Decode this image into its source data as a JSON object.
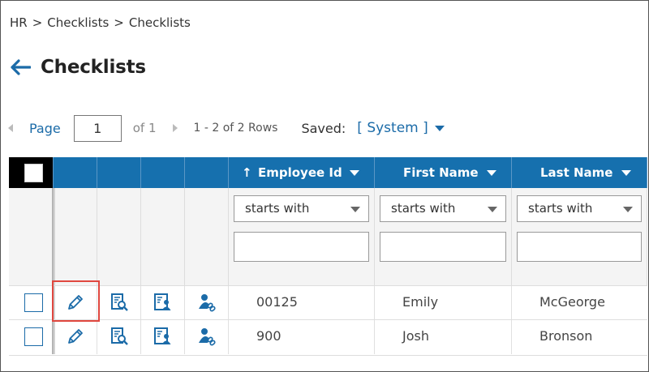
{
  "breadcrumb": {
    "items": [
      "HR",
      "Checklists",
      "Checklists"
    ],
    "separator": ">"
  },
  "page": {
    "title": "Checklists"
  },
  "pager": {
    "page_label": "Page",
    "current_page": "1",
    "of_total": "of 1",
    "rows_info": "1 - 2 of 2 Rows",
    "saved_label": "Saved:",
    "saved_value": "[ System ]"
  },
  "table": {
    "columns": [
      {
        "label": "Employee Id",
        "sort": "ascending"
      },
      {
        "label": "First Name"
      },
      {
        "label": "Last Name"
      }
    ],
    "filter_operator": "starts with",
    "rows": [
      {
        "employee_id": "00125",
        "first_name": "Emily",
        "last_name": "McGeorge"
      },
      {
        "employee_id": "900",
        "first_name": "Josh",
        "last_name": "Bronson"
      }
    ],
    "row_icons": [
      "edit-pencil-icon",
      "view-details-icon",
      "employee-card-icon",
      "user-link-icon"
    ]
  },
  "colors": {
    "accent": "#1670ae",
    "link": "#1b6ba8",
    "highlight": "#e0473f"
  }
}
